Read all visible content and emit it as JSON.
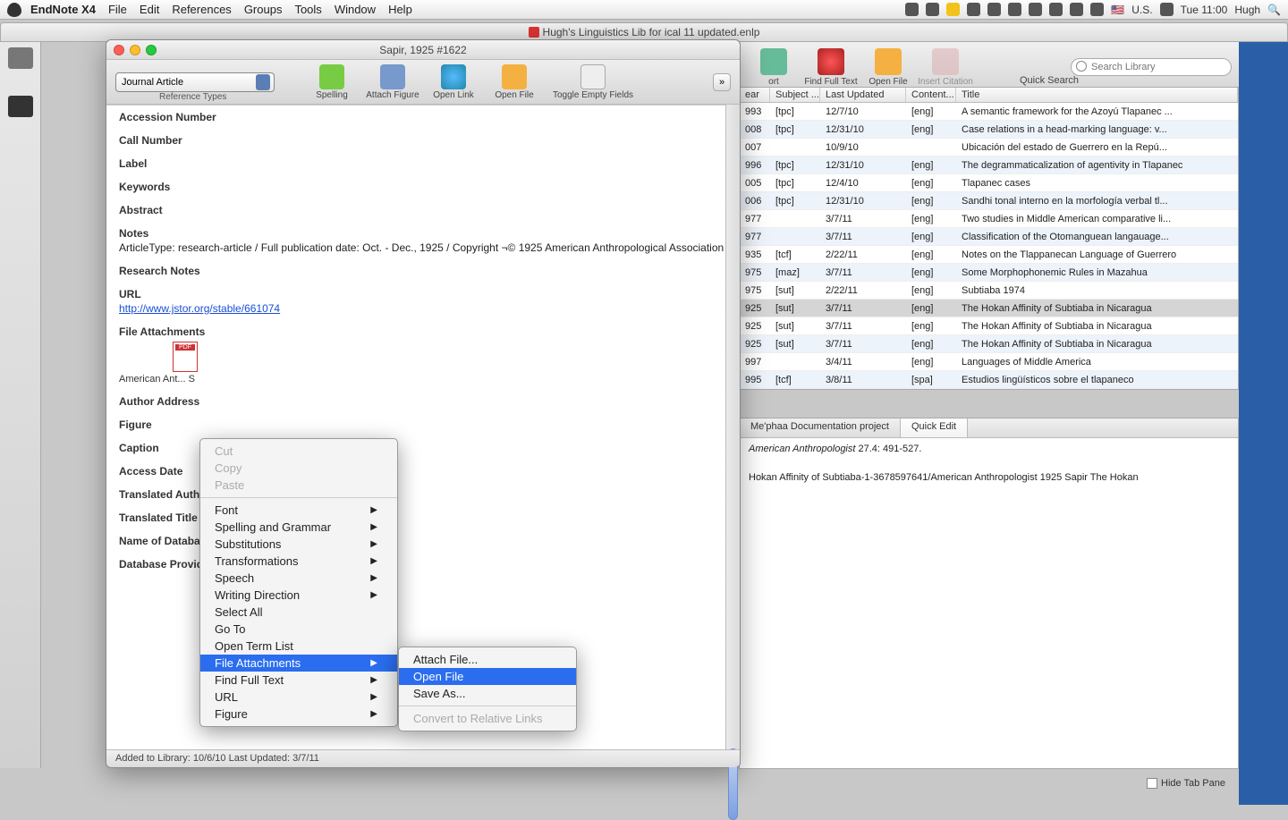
{
  "menubar": {
    "app": "EndNote X4",
    "items": [
      "File",
      "Edit",
      "References",
      "Groups",
      "Tools",
      "Window",
      "Help"
    ],
    "right": {
      "flag": "U.S.",
      "time": "Tue 11:00",
      "user": "Hugh"
    }
  },
  "library": {
    "title": "Hugh's Linguistics Lib for ical 11 updated.enlp",
    "toolbar": {
      "sort": "ort",
      "find_full_text": "Find Full Text",
      "open_file": "Open File",
      "insert_citation": "Insert Citation",
      "search_placeholder": "Search Library",
      "quick_search": "Quick Search"
    },
    "columns": {
      "year": "ear",
      "subject": "Subject ...",
      "last_updated": "Last Updated",
      "content": "Content...",
      "title": "Title"
    },
    "rows": [
      {
        "year": "993",
        "subject": "[tpc]",
        "lu": "12/7/10",
        "content": "[eng]",
        "title": "A semantic framework for the Azoyú Tlapanec ..."
      },
      {
        "year": "008",
        "subject": "[tpc]",
        "lu": "12/31/10",
        "content": "[eng]",
        "title": "Case relations in a head-marking language: v..."
      },
      {
        "year": "007",
        "subject": "",
        "lu": "10/9/10",
        "content": "",
        "title": "Ubicación del estado de Guerrero en la Repú..."
      },
      {
        "year": "996",
        "subject": "[tpc]",
        "lu": "12/31/10",
        "content": "[eng]",
        "title": "The degrammaticalization of agentivity in Tlapanec"
      },
      {
        "year": "005",
        "subject": "[tpc]",
        "lu": "12/4/10",
        "content": "[eng]",
        "title": "Tlapanec cases"
      },
      {
        "year": "006",
        "subject": "[tpc]",
        "lu": "12/31/10",
        "content": "[eng]",
        "title": "Sandhi tonal interno en la morfología verbal tl..."
      },
      {
        "year": "977",
        "subject": "",
        "lu": "3/7/11",
        "content": "[eng]",
        "title": "Two studies in Middle American comparative li..."
      },
      {
        "year": "977",
        "subject": "",
        "lu": "3/7/11",
        "content": "[eng]",
        "title": "Classification of the Otomanguean langauage..."
      },
      {
        "year": "935",
        "subject": "[tcf]",
        "lu": "2/22/11",
        "content": "[eng]",
        "title": "Notes on the Tlappanecan Language of Guerrero"
      },
      {
        "year": "975",
        "subject": "[maz]",
        "lu": "3/7/11",
        "content": "[eng]",
        "title": "Some Morphophonemic Rules in Mazahua"
      },
      {
        "year": "975",
        "subject": "[sut]",
        "lu": "2/22/11",
        "content": "[eng]",
        "title": "Subtiaba 1974"
      },
      {
        "year": "925",
        "subject": "[sut]",
        "lu": "3/7/11",
        "content": "[eng]",
        "title": "The Hokan Affinity of Subtiaba in Nicaragua",
        "sel": true
      },
      {
        "year": "925",
        "subject": "[sut]",
        "lu": "3/7/11",
        "content": "[eng]",
        "title": "The Hokan Affinity of Subtiaba in Nicaragua"
      },
      {
        "year": "925",
        "subject": "[sut]",
        "lu": "3/7/11",
        "content": "[eng]",
        "title": "The Hokan Affinity of Subtiaba in Nicaragua"
      },
      {
        "year": "997",
        "subject": "",
        "lu": "3/4/11",
        "content": "[eng]",
        "title": "Languages of Middle America"
      },
      {
        "year": "995",
        "subject": "[tcf]",
        "lu": "3/8/11",
        "content": "[spa]",
        "title": "Estudios lingüísticos sobre el tlapaneco"
      }
    ],
    "tabs": {
      "t1": "Me'phaa Documentation project",
      "t2": "Quick Edit"
    },
    "preview": {
      "line1a": "American Anthropologist",
      "line1b": " 27.4: 491-527.",
      "line2": "Hokan Affinity of Subtiaba-1-3678597641/American Anthropologist 1925 Sapir The Hokan"
    },
    "hide_tab": "Hide Tab Pane"
  },
  "record": {
    "title": "Sapir, 1925 #1622",
    "reftype": "Journal Article",
    "reftype_label": "Reference Types",
    "tools": {
      "spelling": "Spelling",
      "attach_figure": "Attach Figure",
      "open_link": "Open Link",
      "open_file": "Open File",
      "toggle": "Toggle Empty Fields"
    },
    "fields": {
      "accession": "Accession Number",
      "call": "Call Number",
      "label": "Label",
      "keywords": "Keywords",
      "abstract": "Abstract",
      "notes": "Notes",
      "notes_val": "ArticleType: research-article / Full publication date: Oct. - Dec., 1925 / Copyright ¬© 1925 American Anthropological Association",
      "research": "Research Notes",
      "url_lab": "URL",
      "url_val": "http://www.jstor.org/stable/661074",
      "file_att": "File Attachments",
      "file_cap": "American Ant... S",
      "author_addr": "Author Address",
      "figure": "Figure",
      "caption": "Caption",
      "access_date": "Access Date",
      "trans_auth": "Translated Auth",
      "trans_title": "Translated Title",
      "name_db": "Name of Databa",
      "db_prov": "Database Provider"
    },
    "status": "Added to Library: 10/6/10    Last Updated: 3/7/11"
  },
  "ctx1": {
    "cut": "Cut",
    "copy": "Copy",
    "paste": "Paste",
    "font": "Font",
    "sg": "Spelling and Grammar",
    "sub": "Substitutions",
    "trans": "Transformations",
    "speech": "Speech",
    "wd": "Writing Direction",
    "select_all": "Select All",
    "goto": "Go To",
    "otl": "Open Term List",
    "file_att": "File Attachments",
    "fft": "Find Full Text",
    "url": "URL",
    "figure": "Figure"
  },
  "ctx2": {
    "attach": "Attach File...",
    "open": "Open File",
    "save": "Save As...",
    "convert": "Convert to Relative Links"
  }
}
